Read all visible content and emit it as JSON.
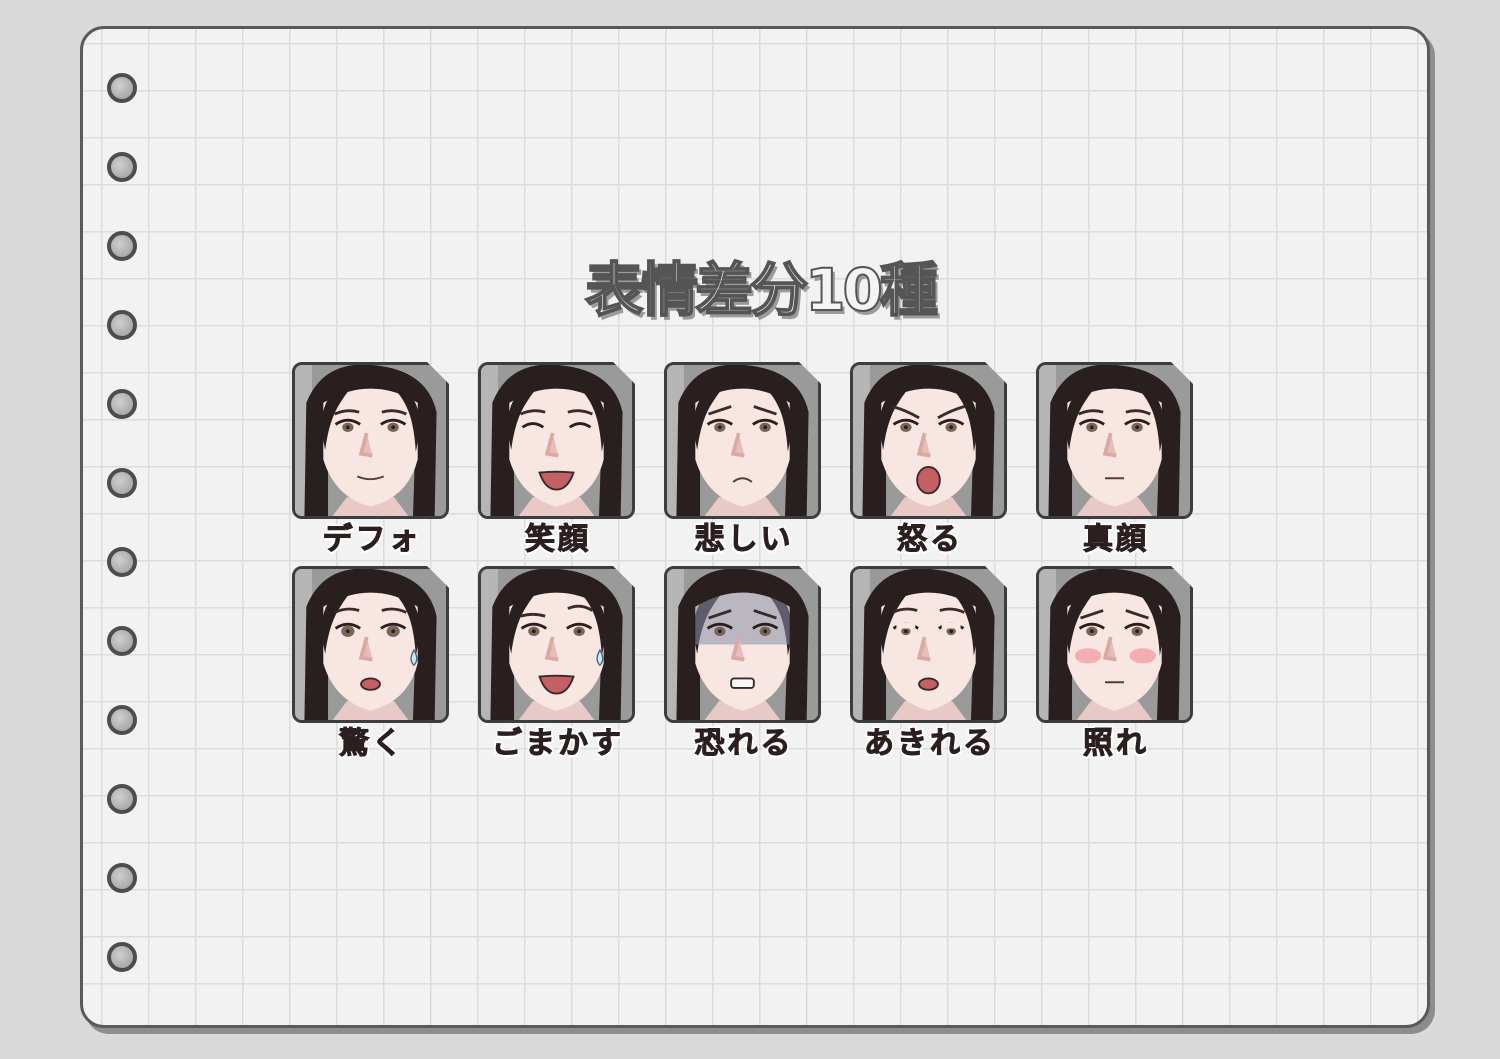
{
  "title": "表情差分10種",
  "expressions": [
    {
      "label": "デフォ"
    },
    {
      "label": "笑顔"
    },
    {
      "label": "悲しい"
    },
    {
      "label": "怒る"
    },
    {
      "label": "真顔"
    },
    {
      "label": "驚く"
    },
    {
      "label": "ごまかす"
    },
    {
      "label": "恐れる"
    },
    {
      "label": "あきれる"
    },
    {
      "label": "照れ"
    }
  ],
  "colors": {
    "paper": "#f2f2f2",
    "grid_line": "#dcdcdc",
    "frame": "#5a5a5a",
    "hair": "#2a1f1f",
    "skin": "#f7e6e2",
    "label_text": "#2b1f1f"
  }
}
